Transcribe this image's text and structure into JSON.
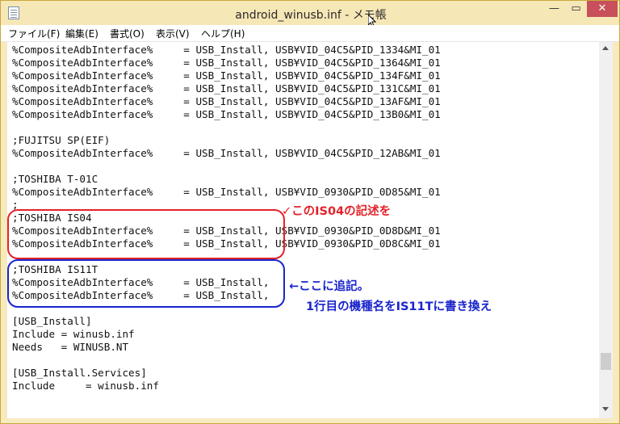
{
  "window": {
    "title": "android_winusb.inf - メモ帳"
  },
  "title_buttons": {
    "minimize": "—",
    "maximize": "▭",
    "close": "✕"
  },
  "menu": [
    "ファイル(F)",
    "編集(E)",
    "書式(O)",
    "表示(V)",
    "ヘルプ(H)"
  ],
  "lines": [
    "%CompositeAdbInterface%     = USB_Install, USB¥VID_04C5&PID_1334&MI_01",
    "%CompositeAdbInterface%     = USB_Install, USB¥VID_04C5&PID_1364&MI_01",
    "%CompositeAdbInterface%     = USB_Install, USB¥VID_04C5&PID_134F&MI_01",
    "%CompositeAdbInterface%     = USB_Install, USB¥VID_04C5&PID_131C&MI_01",
    "%CompositeAdbInterface%     = USB_Install, USB¥VID_04C5&PID_13AF&MI_01",
    "%CompositeAdbInterface%     = USB_Install, USB¥VID_04C5&PID_13B0&MI_01",
    "",
    ";FUJITSU SP(EIF)",
    "%CompositeAdbInterface%     = USB_Install, USB¥VID_04C5&PID_12AB&MI_01",
    "",
    ";TOSHIBA T-01C",
    "%CompositeAdbInterface%     = USB_Install, USB¥VID_0930&PID_0D85&MI_01",
    ";",
    ";TOSHIBA IS04",
    "%CompositeAdbInterface%     = USB_Install, USB¥VID_0930&PID_0D8D&MI_01",
    "%CompositeAdbInterface%     = USB_Install, USB¥VID_0930&PID_0D8C&MI_01",
    "",
    ";TOSHIBA IS11T",
    "%CompositeAdbInterface%     = USB_Install,",
    "%CompositeAdbInterface%     = USB_Install,",
    "",
    "[USB_Install]",
    "Include = winusb.inf",
    "Needs   = WINUSB.NT",
    "",
    "[USB_Install.Services]",
    "Include     = winusb.inf"
  ],
  "annotations": {
    "red": "✓このIS04の記述を",
    "blue_line1": "←ここに追記。",
    "blue_line2": "1行目の機種名をIS11Tに書き換え"
  },
  "colors": {
    "red": "#e3222a",
    "blue": "#1a25cc",
    "window_frame": "#f6e7b6"
  }
}
